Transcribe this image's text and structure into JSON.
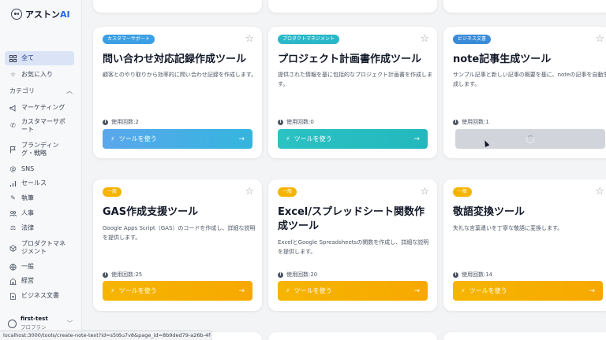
{
  "app": {
    "logo_main": "アストン",
    "logo_ai": "AI"
  },
  "sidebar": {
    "all": "全て",
    "favorites": "お気に入り",
    "category_heading": "カテゴリ",
    "items": [
      {
        "label": "マーケティング",
        "icon": "megaphone-icon"
      },
      {
        "label": "カスタマーサポート",
        "icon": "phone-icon"
      },
      {
        "label": "ブランディング・戦略",
        "icon": "flag-icon"
      },
      {
        "label": "SNS",
        "icon": "at-sign-icon"
      },
      {
        "label": "セールス",
        "icon": "bar-chart-icon"
      },
      {
        "label": "執筆",
        "icon": "pencil-icon"
      },
      {
        "label": "人事",
        "icon": "users-icon"
      },
      {
        "label": "法律",
        "icon": "scale-icon"
      },
      {
        "label": "プロダクトマネジメント",
        "icon": "cube-icon"
      },
      {
        "label": "一般",
        "icon": "globe-icon"
      },
      {
        "label": "経営",
        "icon": "building-icon"
      },
      {
        "label": "ビジネス文書",
        "icon": "document-icon"
      }
    ],
    "user": {
      "name": "first-test",
      "plan": "プロプラン"
    }
  },
  "cards": [
    {
      "badge": "カスタマーサポート",
      "title": "問い合わせ対応記録作成ツール",
      "desc": "顧客とのやり取りから効率的に問い合わせ記録を作成します。",
      "usage": "使用回数:2",
      "button": "ツールを使う"
    },
    {
      "badge": "プロダクトマネジメント",
      "title": "プロジェクト計画書作成ツール",
      "desc": "提供された情報を基に包括的なプロジェクト計画書を作成します。",
      "usage": "使用回数:0",
      "button": "ツールを使う"
    },
    {
      "badge": "ビジネス文書",
      "title": "note記事生成ツール",
      "desc": "サンプル記事と新しい記事の概要を基に、noteの記事を自動生成します。",
      "usage": "使用回数:1",
      "button": ""
    },
    {
      "badge": "一般",
      "title": "GAS作成支援ツール",
      "desc": "Google Apps Script（GAS）のコードを作成し、詳細な説明を提供します。",
      "usage": "使用回数:25",
      "button": "ツールを使う"
    },
    {
      "badge": "一般",
      "title": "Excel/スプレッドシート関数作成ツール",
      "desc": "ExcelとGoogle Spreadsheetsの関数を作成し、詳細な説明を提供します。",
      "usage": "使用回数:20",
      "button": "ツールを使う"
    },
    {
      "badge": "一般",
      "title": "敬語変換ツール",
      "desc": "失礼な言葉遣いを丁寧な敬語に変換します。",
      "usage": "使用回数:14",
      "button": "ツールを使う"
    }
  ],
  "status_url": "localhost:3000/tools/create-note-text?id=s5t6u7v8&page_id=8b9ded79-a26b-4f49..."
}
